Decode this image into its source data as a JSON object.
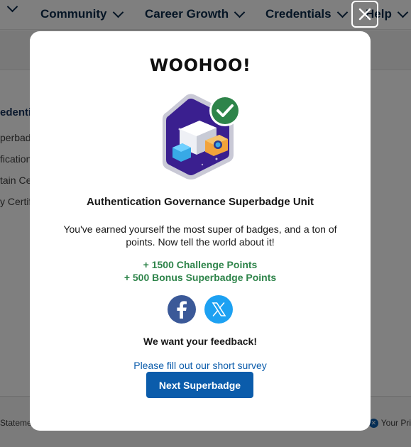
{
  "nav": {
    "items": [
      {
        "label": "Community"
      },
      {
        "label": "Career Growth"
      },
      {
        "label": "Credentials"
      },
      {
        "label": "Help"
      }
    ]
  },
  "sidebar": {
    "heading": "edentia",
    "items": [
      "perbadge",
      "fication",
      "tain Ce",
      "y Certif"
    ]
  },
  "footer": {
    "left_text": "Stateme",
    "right_text": "Your Pri"
  },
  "modal": {
    "close_icon": "close-icon",
    "title": "WOOHOO!",
    "badge_name": "Authentication Governance Superbadge Unit",
    "description": "You've earned yourself the most super of badges, and a ton of points. Now tell the world about it!",
    "challenge_points": "+ 1500 Challenge Points",
    "bonus_points": "+ 500 Bonus Superbadge Points",
    "share": {
      "facebook_icon": "facebook-icon",
      "x_icon": "x-icon"
    },
    "feedback_heading": "We want your feedback!",
    "survey_link": "Please fill out our short survey",
    "next_button": "Next Superbadge"
  },
  "colors": {
    "accent": "#0b5cab",
    "success": "#2e844a",
    "badge_purple": "#3a1f8f",
    "check_green": "#2e844a"
  }
}
